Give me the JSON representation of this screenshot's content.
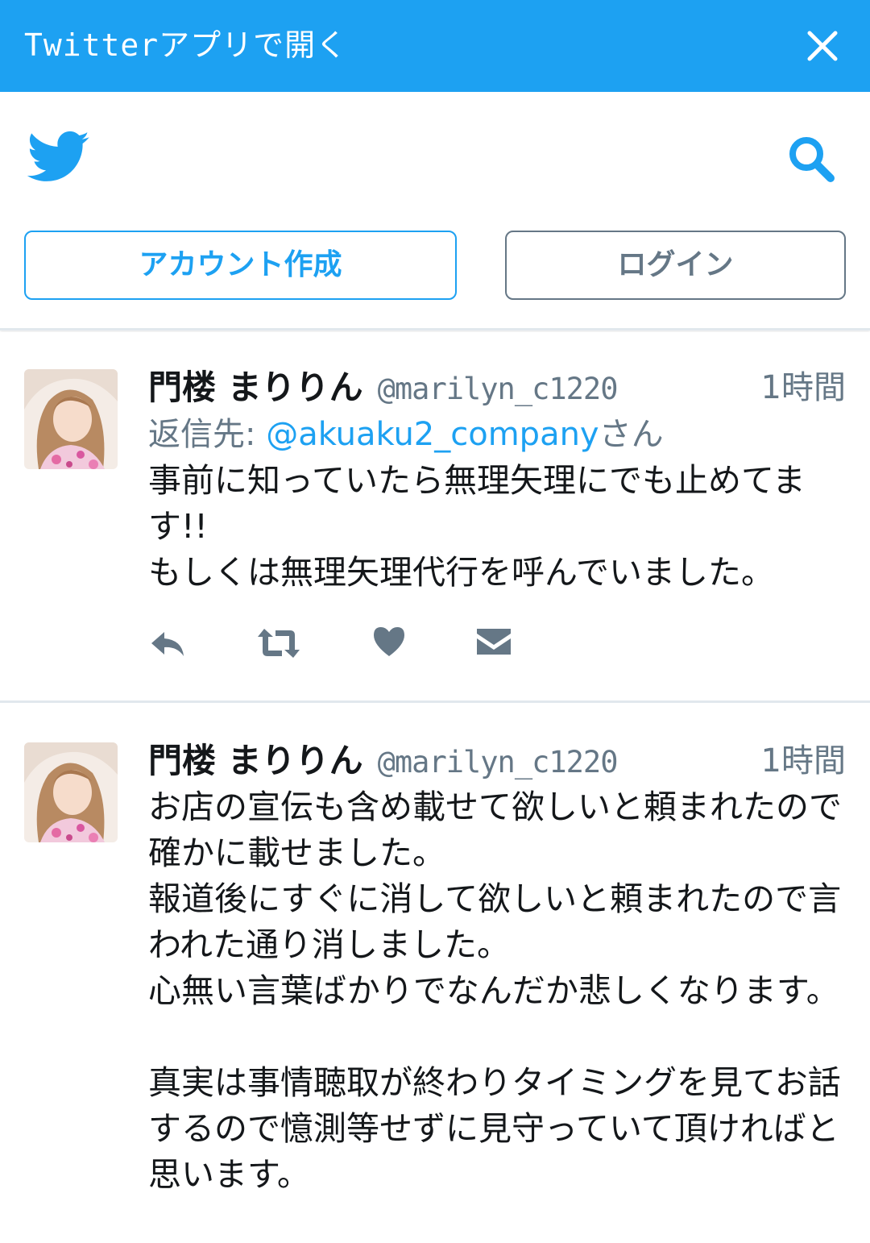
{
  "banner": {
    "title": "Twitterアプリで開く",
    "close_icon": "close-icon"
  },
  "header": {
    "logo_icon": "twitter-bird-icon",
    "search_icon": "search-icon",
    "signup_label": "アカウント作成",
    "login_label": "ログイン"
  },
  "colors": {
    "brand_blue": "#1da1f2",
    "secondary_text": "#657786",
    "divider": "#e1e8ed"
  },
  "tweets": [
    {
      "name": "門楼 まりりん",
      "handle": "@marilyn_c1220",
      "time": "1時間",
      "reply_prefix": "返信先: ",
      "reply_to": "@akuaku2_company",
      "reply_suffix": "さん",
      "text": "事前に知っていたら無理矢理にでも止めてます!!\nもしくは無理矢理代行を呼んでいました。",
      "actions": [
        "reply-icon",
        "retweet-icon",
        "like-icon",
        "direct-message-icon"
      ]
    },
    {
      "name": "門楼 まりりん",
      "handle": "@marilyn_c1220",
      "time": "1時間",
      "text": "お店の宣伝も含め載せて欲しいと頼まれたので確かに載せました。\n報道後にすぐに消して欲しいと頼まれたので言われた通り消しました。\n心無い言葉ばかりでなんだか悲しくなります。\n\n真実は事情聴取が終わりタイミングを見てお話するので憶測等せずに見守っていて頂ければと思います。"
    }
  ]
}
